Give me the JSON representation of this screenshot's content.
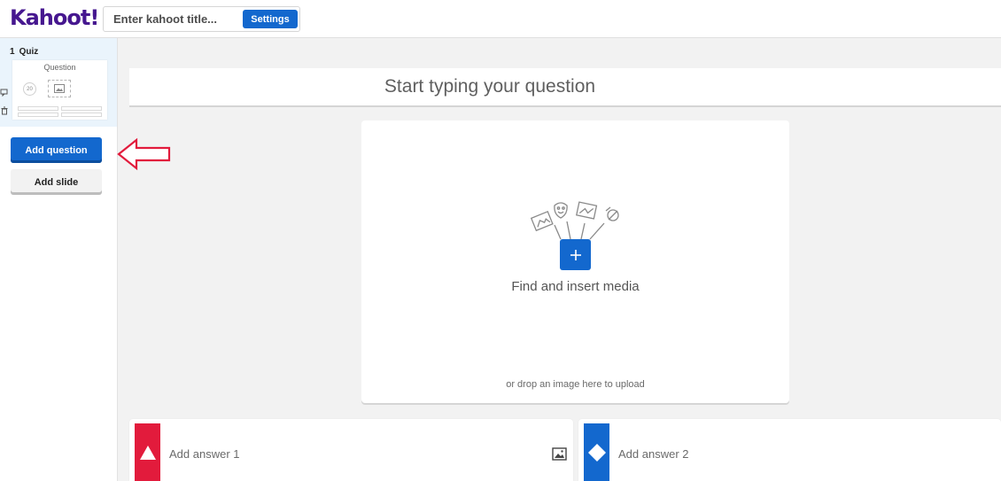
{
  "header": {
    "logo_text": "Kahoot!",
    "title_placeholder": "Enter kahoot title...",
    "settings_label": "Settings"
  },
  "sidebar": {
    "slides": [
      {
        "number": "1",
        "type": "Quiz",
        "thumb_title": "Question",
        "thumb_timer": "20"
      }
    ],
    "add_question_label": "Add question",
    "add_slide_label": "Add slide"
  },
  "editor": {
    "question_placeholder": "Start typing your question",
    "media_label": "Find and insert media",
    "drop_label": "or drop an image here to upload",
    "answers": [
      {
        "placeholder": "Add answer 1",
        "color": "#e21b3c",
        "shape": "triangle"
      },
      {
        "placeholder": "Add answer 2",
        "color": "#1368ce",
        "shape": "diamond"
      }
    ]
  },
  "colors": {
    "brand": "#46178f",
    "primary": "#1368ce",
    "annotation_arrow": "#e21b3c"
  }
}
